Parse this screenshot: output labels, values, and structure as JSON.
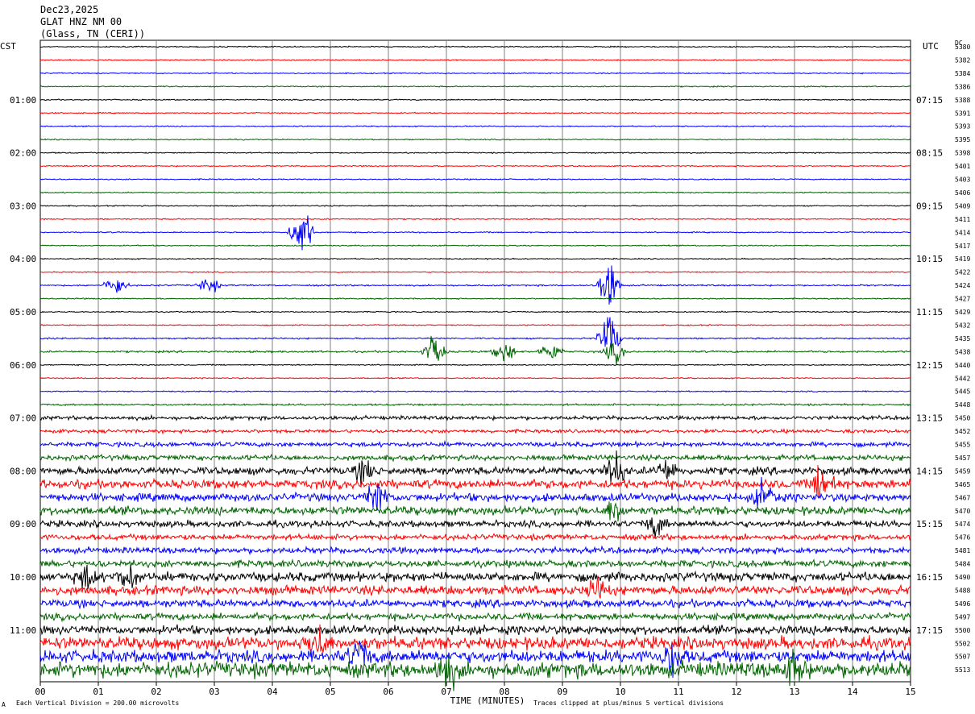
{
  "header": {
    "date": "Dec23,2025",
    "station": "GLAT HNZ NM 00",
    "location": "(Glass, TN (CERI))"
  },
  "left_zone": "CST",
  "right_zone": "UTC",
  "dc_label": "DC",
  "footer": {
    "scale_note": "Each Vertical Division =  200.00 microvolts",
    "clip_note": "Traces clipped at plus/minus 5 vertical divisions",
    "corner_mark": "A"
  },
  "colors": {
    "black": "#000000",
    "red": "#ff0000",
    "blue": "#0000ff",
    "green": "#006400",
    "grid": "#808080"
  },
  "chart_data": {
    "type": "line",
    "xlabel": "TIME (MINUTES)",
    "xlim": [
      0,
      15
    ],
    "x_ticks": [
      "00",
      "01",
      "02",
      "03",
      "04",
      "05",
      "06",
      "07",
      "08",
      "09",
      "10",
      "11",
      "12",
      "13",
      "14",
      "15"
    ],
    "left_hour_labels": [
      "01:00",
      "02:00",
      "03:00",
      "04:00",
      "05:00",
      "06:00",
      "07:00",
      "08:00",
      "09:00",
      "10:00",
      "11:00"
    ],
    "right_hour_labels": [
      "07:15",
      "08:15",
      "09:15",
      "10:15",
      "11:15",
      "12:15",
      "13:15",
      "14:15",
      "15:15",
      "16:15",
      "17:15"
    ],
    "trace_color_cycle": [
      "black",
      "red",
      "blue",
      "green"
    ],
    "dc_offsets": [
      "5380",
      "5382",
      "5384",
      "5386",
      "5388",
      "5391",
      "5393",
      "5395",
      "5398",
      "5401",
      "5403",
      "5406",
      "5409",
      "5411",
      "5414",
      "5417",
      "5419",
      "5422",
      "5424",
      "5427",
      "5429",
      "5432",
      "5435",
      "5438",
      "5440",
      "5442",
      "5445",
      "5448",
      "5450",
      "5452",
      "5455",
      "5457",
      "5459",
      "5465",
      "5467",
      "5470",
      "5474",
      "5476",
      "5481",
      "5484",
      "5490",
      "5488",
      "5496",
      "5497",
      "5500",
      "5502",
      "5507",
      "5513"
    ],
    "trace_noise_level": [
      0.3,
      0.3,
      0.3,
      0.3,
      0.3,
      0.3,
      0.3,
      0.3,
      0.3,
      0.3,
      0.3,
      0.3,
      0.3,
      0.3,
      0.3,
      0.3,
      0.3,
      0.3,
      0.4,
      0.3,
      0.3,
      0.3,
      0.4,
      0.5,
      0.3,
      0.3,
      0.3,
      0.5,
      1.0,
      0.9,
      1.2,
      1.4,
      2.0,
      2.3,
      2.1,
      2.2,
      1.7,
      1.5,
      1.6,
      1.8,
      2.4,
      2.4,
      2.0,
      1.8,
      2.3,
      3.2,
      3.2,
      4.0
    ],
    "events": [
      {
        "trace": 14,
        "minute": 4.5,
        "amplitude": 5
      },
      {
        "trace": 18,
        "minute": 1.3,
        "amplitude": 2
      },
      {
        "trace": 18,
        "minute": 2.9,
        "amplitude": 1.5
      },
      {
        "trace": 18,
        "minute": 9.8,
        "amplitude": 5
      },
      {
        "trace": 22,
        "minute": 9.8,
        "amplitude": 5
      },
      {
        "trace": 23,
        "minute": 6.8,
        "amplitude": 3
      },
      {
        "trace": 23,
        "minute": 8.0,
        "amplitude": 2
      },
      {
        "trace": 23,
        "minute": 8.8,
        "amplitude": 2
      },
      {
        "trace": 23,
        "minute": 9.9,
        "amplitude": 2
      },
      {
        "trace": 32,
        "minute": 5.6,
        "amplitude": 2
      },
      {
        "trace": 32,
        "minute": 9.9,
        "amplitude": 3
      },
      {
        "trace": 32,
        "minute": 10.8,
        "amplitude": 2
      },
      {
        "trace": 33,
        "minute": 13.5,
        "amplitude": 4
      },
      {
        "trace": 34,
        "minute": 5.8,
        "amplitude": 3
      },
      {
        "trace": 34,
        "minute": 12.5,
        "amplitude": 3
      },
      {
        "trace": 35,
        "minute": 9.9,
        "amplitude": 2
      },
      {
        "trace": 36,
        "minute": 10.6,
        "amplitude": 2
      },
      {
        "trace": 40,
        "minute": 0.8,
        "amplitude": 2
      },
      {
        "trace": 40,
        "minute": 1.5,
        "amplitude": 2
      },
      {
        "trace": 41,
        "minute": 9.6,
        "amplitude": 2
      },
      {
        "trace": 45,
        "minute": 4.8,
        "amplitude": 3
      },
      {
        "trace": 46,
        "minute": 5.5,
        "amplitude": 3
      },
      {
        "trace": 46,
        "minute": 10.9,
        "amplitude": 3
      },
      {
        "trace": 47,
        "minute": 7.0,
        "amplitude": 3
      },
      {
        "trace": 47,
        "minute": 13.0,
        "amplitude": 3
      }
    ]
  }
}
